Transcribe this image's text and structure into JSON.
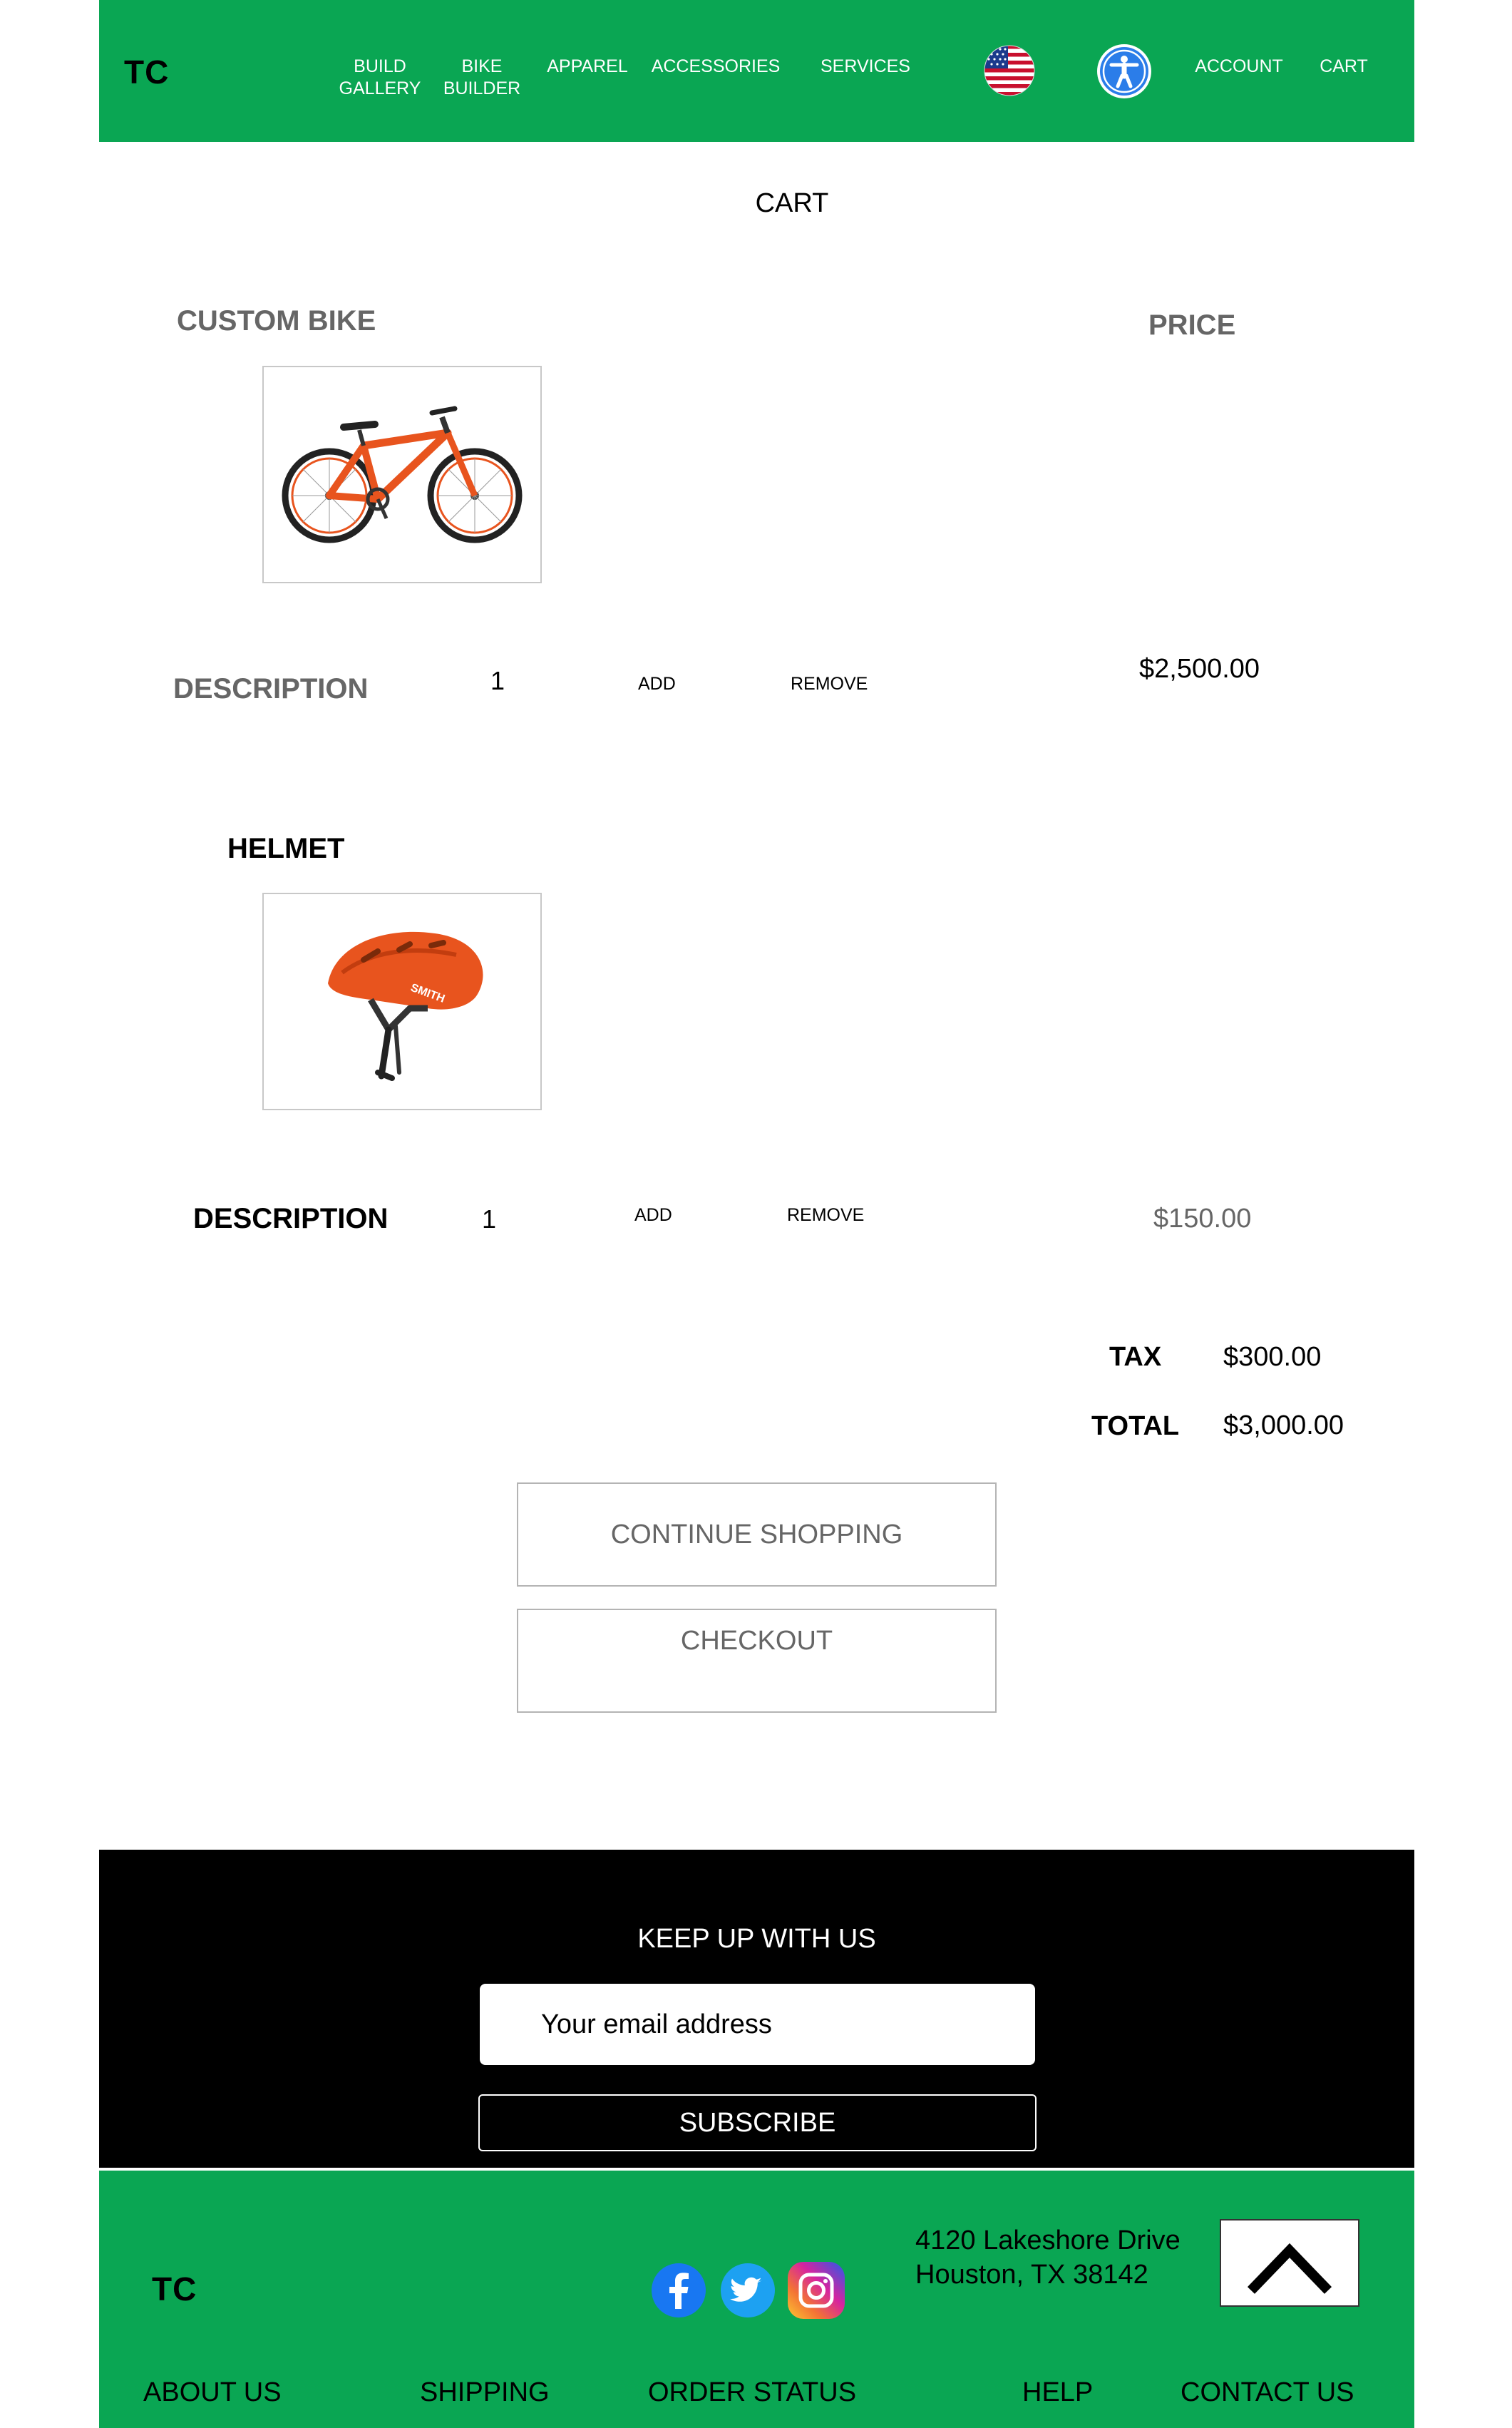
{
  "header": {
    "logo": "TC",
    "nav": [
      {
        "line1": "BUILD",
        "line2": "GALLERY"
      },
      {
        "line1": "BIKE",
        "line2": "BUILDER"
      },
      {
        "line1": "APPAREL",
        "line2": ""
      },
      {
        "line1": "ACCESSORIES",
        "line2": ""
      },
      {
        "line1": "SERVICES",
        "line2": ""
      }
    ],
    "account": "ACCOUNT",
    "cart": "CART",
    "icons": [
      "us-flag-icon",
      "accessibility-icon"
    ]
  },
  "page_title": "CART",
  "cart": {
    "price_header": "PRICE",
    "items": [
      {
        "name": "CUSTOM BIKE",
        "description_label": "DESCRIPTION",
        "quantity": "1",
        "add": "ADD",
        "remove": "REMOVE",
        "price": "$2,500.00",
        "image": "orange-bike-image"
      },
      {
        "name": "HELMET",
        "description_label": "DESCRIPTION",
        "quantity": "1",
        "add": "ADD",
        "remove": "REMOVE",
        "price": "$150.00",
        "image": "orange-helmet-image"
      }
    ],
    "helmet_brand": "SMITH",
    "tax_label": "TAX",
    "tax_value": "$300.00",
    "total_label": "TOTAL",
    "total_value": "$3,000.00",
    "continue_label": "CONTINUE SHOPPING",
    "checkout_label": "CHECKOUT"
  },
  "newsletter": {
    "title": "KEEP UP WITH US",
    "email_placeholder": "Your email address",
    "subscribe": "SUBSCRIBE"
  },
  "footer": {
    "logo": "TC",
    "address_line1": "4120 Lakeshore Drive",
    "address_line2": "Houston, TX 38142",
    "social": [
      "facebook-icon",
      "twitter-icon",
      "instagram-icon"
    ],
    "links": [
      "ABOUT US",
      "SHIPPING",
      "ORDER STATUS",
      "HELP",
      "CONTACT US"
    ]
  },
  "colors": {
    "brand_green": "#0aa653",
    "newsletter_bg": "#000000",
    "muted_text": "#666666",
    "product_orange": "#e8541e"
  }
}
